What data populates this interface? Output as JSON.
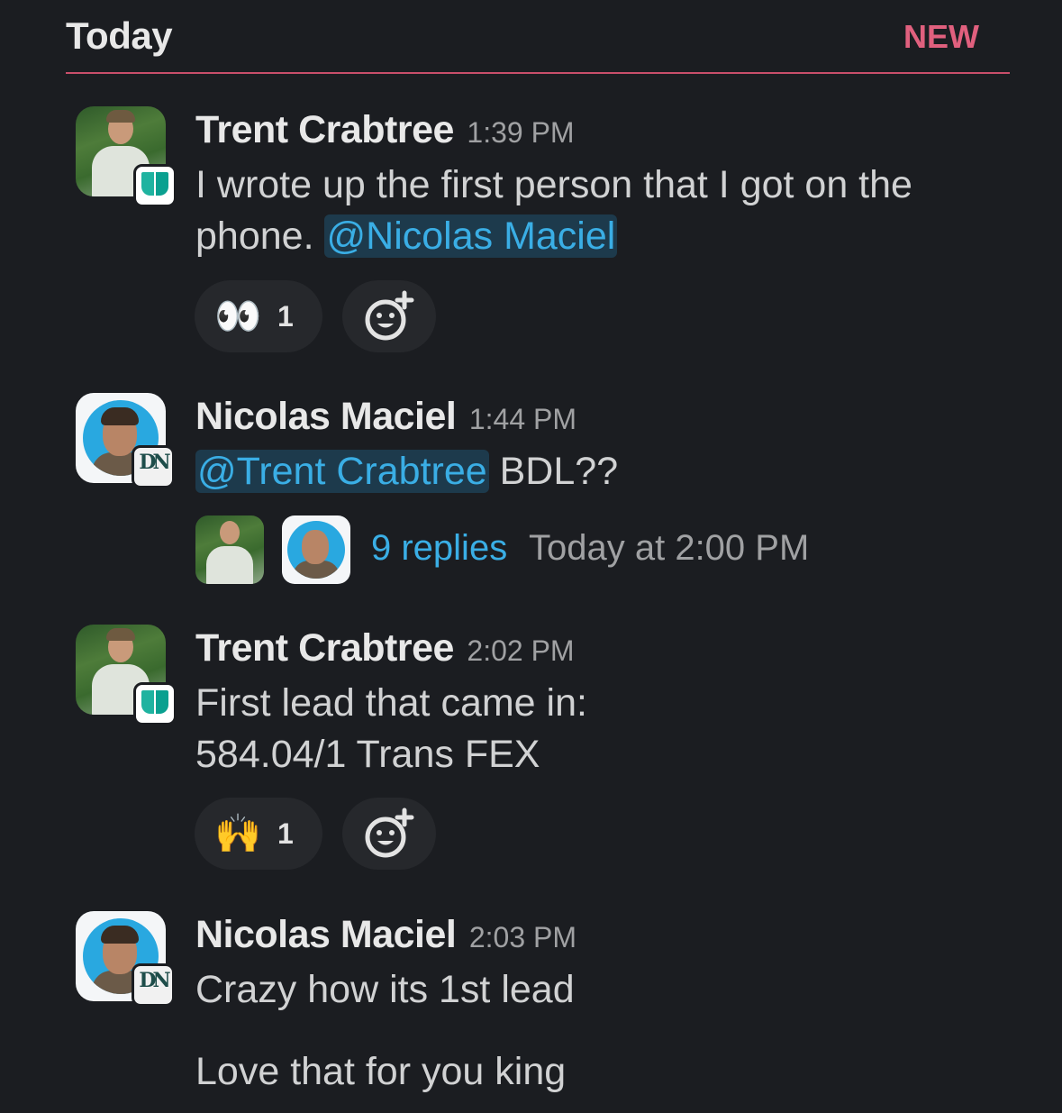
{
  "header": {
    "day_label": "Today",
    "new_label": "NEW"
  },
  "colors": {
    "background": "#1b1d21",
    "new_divider": "#e0607e",
    "mention": "#3aaee5",
    "mention_bg": "#1d3a4c"
  },
  "messages": [
    {
      "author": "Trent Crabtree",
      "time": "1:39 PM",
      "text_before": "I wrote up the first person that I got on the phone.",
      "mention": "@Nicolas Maciel",
      "reaction": {
        "emoji": "👀",
        "count": "1"
      }
    },
    {
      "author": "Nicolas Maciel",
      "time": "1:44 PM",
      "mention": "@Trent Crabtree",
      "text_after": "BDL??",
      "thread": {
        "replies": "9 replies",
        "last_reply": "Today at 2:00 PM"
      }
    },
    {
      "author": "Trent Crabtree",
      "time": "2:02 PM",
      "line1": "First lead that came in:",
      "line2": "584.04/1 Trans FEX",
      "reaction": {
        "emoji": "🙌",
        "count": "1"
      }
    },
    {
      "author": "Nicolas Maciel",
      "time": "2:03 PM",
      "line1": "Crazy how its 1st lead",
      "line2": "Love that for you king"
    }
  ]
}
